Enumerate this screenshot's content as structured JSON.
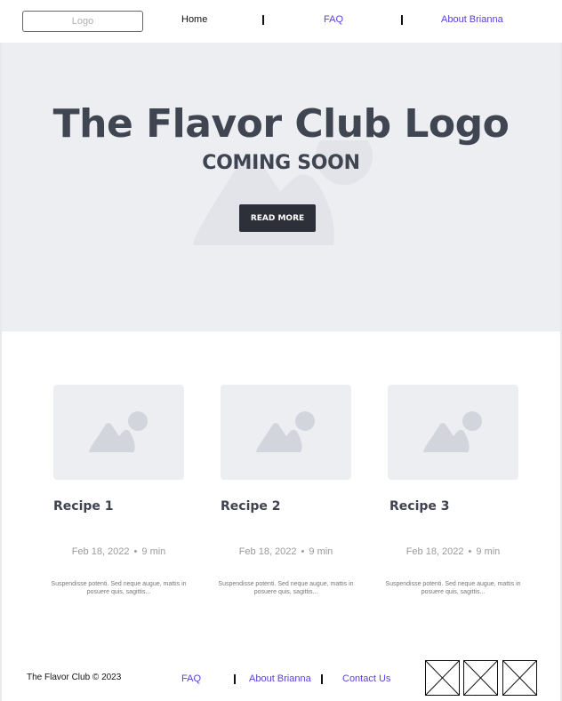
{
  "header": {
    "logo_label": "Logo",
    "nav": [
      {
        "label": "Home"
      },
      {
        "label": "FAQ"
      },
      {
        "label": "About Brianna"
      }
    ]
  },
  "hero": {
    "title": "The Flavor Club Logo",
    "subtitle": "COMING SOON",
    "button_label": "READ MORE"
  },
  "recipes": [
    {
      "title": "Recipe 1",
      "date": "Feb 18, 2022",
      "separator": "•",
      "duration": "9 min",
      "excerpt": "Suspendisse potenti. Sed neque augue, mattis in posuere quis, sagittis..."
    },
    {
      "title": "Recipe 2",
      "date": "Feb 18, 2022",
      "separator": "•",
      "duration": "9 min",
      "excerpt": "Suspendisse potenti. Sed neque augue, mattis in posuere quis, sagittis..."
    },
    {
      "title": "Recipe 3",
      "date": "Feb 18, 2022",
      "separator": "•",
      "duration": "9 min",
      "excerpt": "Suspendisse potenti. Sed neque augue, mattis in posuere quis, sagittis..."
    }
  ],
  "footer": {
    "copyright": "The Flavor Club © 2023",
    "links": [
      {
        "label": "FAQ"
      },
      {
        "label": "About Brianna"
      },
      {
        "label": "Contact Us"
      }
    ],
    "social_icons": [
      "social-placeholder-icon",
      "social-placeholder-icon",
      "social-placeholder-icon"
    ]
  },
  "colors": {
    "link": "#5b3fd9",
    "hero_bg": "#edeef2",
    "heading": "#404552",
    "button_bg": "#2d3039"
  }
}
